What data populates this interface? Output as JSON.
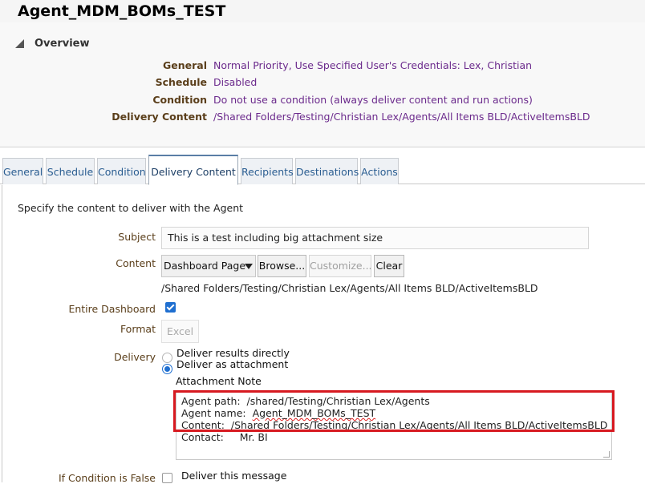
{
  "page_title": "Agent_MDM_BOMs_TEST",
  "overview": {
    "label": "Overview",
    "rows": [
      {
        "key": "General",
        "value": "Normal Priority, Use Specified User's Credentials: Lex, Christian"
      },
      {
        "key": "Schedule",
        "value": "Disabled"
      },
      {
        "key": "Condition",
        "value": "Do not use a condition (always deliver content and run actions)"
      },
      {
        "key": "Delivery Content",
        "value": "/Shared Folders/Testing/Christian Lex/Agents/All Items BLD/ActiveItemsBLD"
      }
    ]
  },
  "tabs": [
    {
      "label": "General"
    },
    {
      "label": "Schedule"
    },
    {
      "label": "Condition"
    },
    {
      "label": "Delivery Content",
      "active": true
    },
    {
      "label": "Recipients"
    },
    {
      "label": "Destinations"
    },
    {
      "label": "Actions"
    }
  ],
  "form": {
    "intro": "Specify the content to deliver with the Agent",
    "subject_label": "Subject",
    "subject_value": "This is a test including big attachment size",
    "content_label": "Content",
    "content_select": "Dashboard Page",
    "browse_label": "Browse...",
    "customize_label": "Customize...",
    "clear_label": "Clear",
    "content_path": "/Shared Folders/Testing/Christian Lex/Agents/All Items BLD/ActiveItemsBLD",
    "entire_dashboard_label": "Entire Dashboard",
    "entire_dashboard_checked": true,
    "format_label": "Format",
    "format_value": "Excel",
    "delivery_label": "Delivery",
    "delivery_options": [
      {
        "label": "Deliver results directly",
        "selected": false
      },
      {
        "label": "Deliver as attachment",
        "selected": true
      }
    ],
    "attachment_note_label": "Attachment Note",
    "note_lines": {
      "path_prefix": "Agent path:  /shared/Testing/Christian Lex/Agents",
      "name_prefix": "Agent name:  ",
      "name_value": "Agent_MDM_BOMs_TEST",
      "content_prefix": "Content:  ",
      "content_value": "/Shared Folders/Testing/Christian Lex/Agents/All Items BLD/ActiveItemsBLD",
      "contact": "Contact:     Mr. BI"
    },
    "if_condition_false_label": "If Condition is False",
    "deliver_this_message_label": "Deliver this message",
    "deliver_this_message_checked": false
  },
  "colors": {
    "highlight_border": "#d71920",
    "link_value": "#6b2a8c",
    "label_brown": "#5a3e1a",
    "checkbox_blue": "#1f6fd0"
  }
}
